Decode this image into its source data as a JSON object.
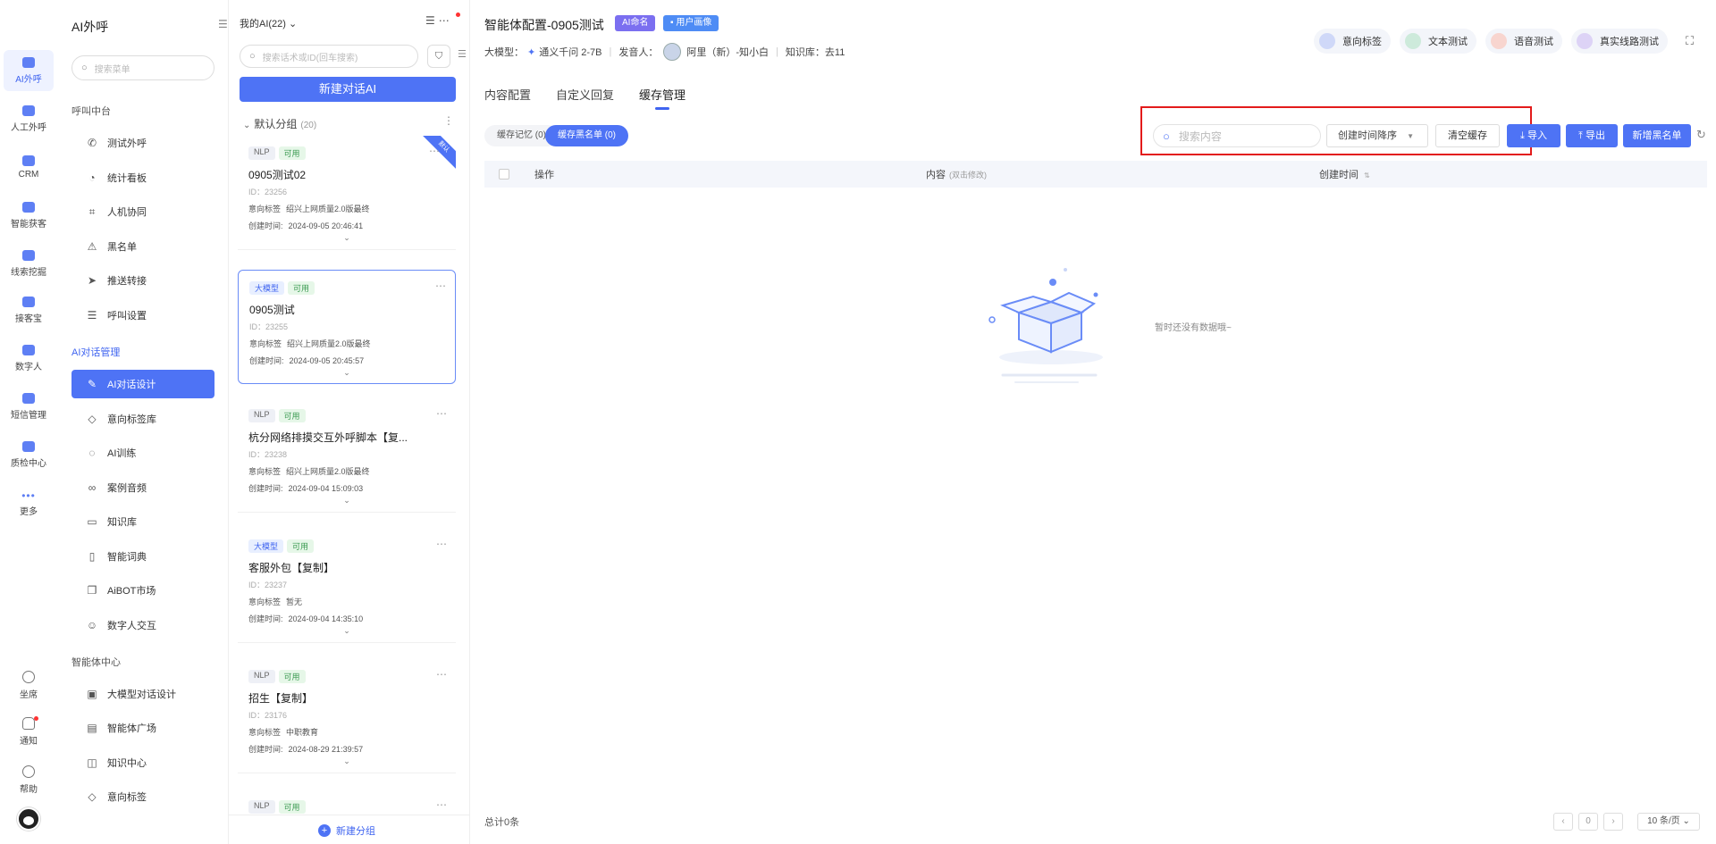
{
  "rail": {
    "items": [
      {
        "label": "AI外呼",
        "active": true
      },
      {
        "label": "人工外呼"
      },
      {
        "label": "CRM"
      },
      {
        "label": "智能获客"
      },
      {
        "label": "线索挖掘"
      },
      {
        "label": "接客宝"
      },
      {
        "label": "数字人"
      },
      {
        "label": "短信管理"
      },
      {
        "label": "质检中心"
      },
      {
        "label": "更多"
      }
    ],
    "bottom": [
      {
        "label": "坐席"
      },
      {
        "label": "通知"
      },
      {
        "label": "帮助"
      }
    ]
  },
  "menu": {
    "title": "AI外呼",
    "search_placeholder": "搜索菜单",
    "group1": "呼叫中台",
    "group1_items": [
      "测试外呼",
      "统计看板",
      "人机协同",
      "黑名单",
      "推送转接",
      "呼叫设置"
    ],
    "group2": "AI对话管理",
    "group2_items": [
      "AI对话设计",
      "意向标签库",
      "AI训练",
      "案例音频",
      "知识库",
      "智能词典",
      "AiBOT市场",
      "数字人交互"
    ],
    "group3": "智能体中心",
    "group3_items": [
      "大模型对话设计",
      "智能体广场",
      "知识中心",
      "意向标签"
    ]
  },
  "list": {
    "selector": "我的AI(22)",
    "search_placeholder": "搜索话术或ID(回车搜索)",
    "new_button": "新建对话AI",
    "group_name": "默认分组",
    "group_count": "(20)",
    "intent_label": "意向标签",
    "time_label": "创建时间:",
    "corner": "默认",
    "cards": [
      {
        "type": "NLP",
        "status": "可用",
        "name": "0905测试02",
        "id": "ID：23256",
        "intent": "绍兴上网质量2.0版最终",
        "time": "2024-09-05 20:46:41"
      },
      {
        "type": "大模型",
        "status": "可用",
        "name": "0905测试",
        "id": "ID：23255",
        "intent": "绍兴上网质量2.0版最终",
        "time": "2024-09-05 20:45:57"
      },
      {
        "type": "NLP",
        "status": "可用",
        "name": "杭分网络排摸交互外呼脚本【复...",
        "id": "ID：23238",
        "intent": "绍兴上网质量2.0版最终",
        "time": "2024-09-04 15:09:03"
      },
      {
        "type": "大模型",
        "status": "可用",
        "name": "客服外包【复制】",
        "id": "ID：23237",
        "intent": "暂无",
        "time": "2024-09-04 14:35:10"
      },
      {
        "type": "NLP",
        "status": "可用",
        "name": "招生【复制】",
        "id": "ID：23176",
        "intent": "中职教育",
        "time": "2024-08-29 21:39:57"
      },
      {
        "type": "NLP",
        "status": "可用",
        "name": "",
        "id": "",
        "intent": "",
        "time": ""
      }
    ],
    "new_group": "新建分组"
  },
  "main": {
    "title": "智能体配置-0905测试",
    "badge1": "AI命名",
    "badge2": "用户画像",
    "meta_model_label": "大模型：",
    "meta_model": "通义千问 2-7B",
    "meta_speaker_label": "发音人：",
    "meta_speaker": "阿里（新）-知小白",
    "meta_kb": "知识库：去11",
    "tools": [
      "意向标签",
      "文本测试",
      "语音测试",
      "真实线路测试"
    ],
    "tabs": [
      "内容配置",
      "自定义回复",
      "缓存管理"
    ],
    "subtabs": [
      {
        "label": "缓存记忆",
        "count": "(0)"
      },
      {
        "label": "缓存黑名单",
        "count": "(0)"
      }
    ],
    "search_placeholder": "搜索内容",
    "sort_label": "创建时间降序",
    "clear_button": "清空缓存",
    "import_button": "导入",
    "export_button": "导出",
    "add_blacklist_button": "新增黑名单",
    "table_headers": {
      "action": "操作",
      "content": "内容",
      "content_hint": "(双击修改)",
      "created": "创建时间"
    },
    "empty_text": "暂时还没有数据哦~",
    "total": "总计0条",
    "page": "0",
    "page_size": "10 条/页"
  }
}
